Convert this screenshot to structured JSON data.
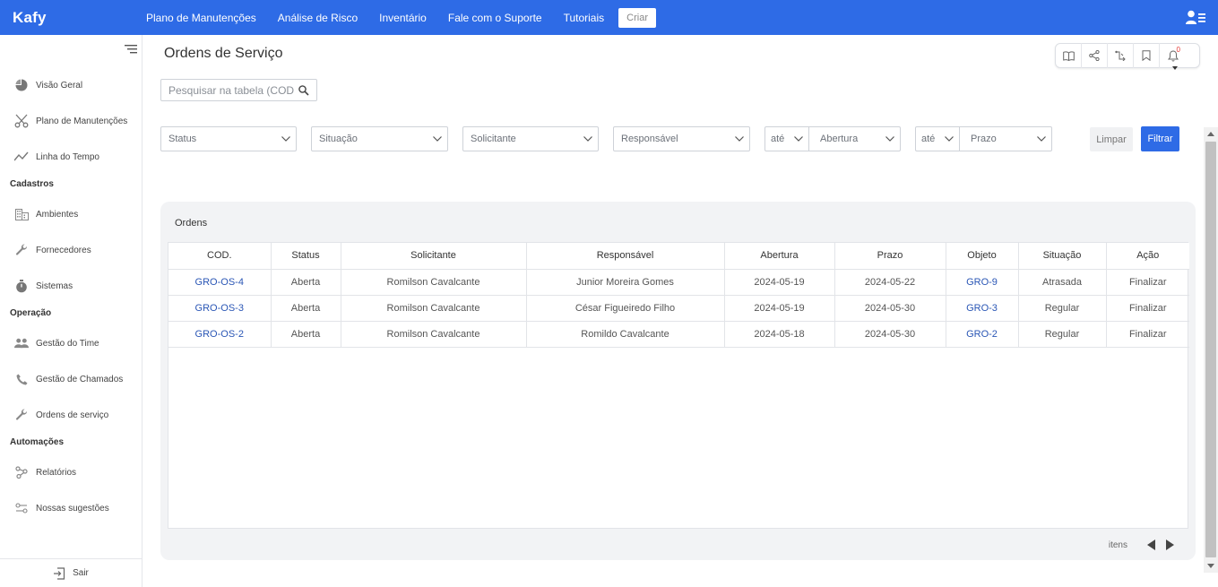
{
  "app": {
    "logo": "Kafy"
  },
  "topnav": {
    "items": [
      "Plano de Manutenções",
      "Análise de Risco",
      "Inventário",
      "Fale com o Suporte",
      "Tutoriais"
    ],
    "create_label": "Criar"
  },
  "sidebar": {
    "items": [
      {
        "label": "Visão Geral",
        "icon": "pie-chart-icon"
      },
      {
        "label": "Plano de Manutenções",
        "icon": "scissors-icon"
      },
      {
        "label": "Linha do Tempo",
        "icon": "line-chart-icon"
      },
      {
        "label": "Ambientes",
        "icon": "building-icon"
      },
      {
        "label": "Fornecedores",
        "icon": "wrench-icon"
      },
      {
        "label": "Sistemas",
        "icon": "stopwatch-icon"
      },
      {
        "label": "Gestão do Time",
        "icon": "team-icon"
      },
      {
        "label": "Gestão de Chamados",
        "icon": "phone-icon"
      },
      {
        "label": "Ordens de serviço",
        "icon": "wrench-icon"
      },
      {
        "label": "Relatórios",
        "icon": "nodes-icon"
      },
      {
        "label": "Nossas sugestões",
        "icon": "toggles-icon"
      }
    ],
    "sections": {
      "cadastros": "Cadastros",
      "operacao": "Operação",
      "automacoes": "Automações"
    },
    "logout_label": "Sair"
  },
  "page": {
    "title": "Ordens de Serviço",
    "search_placeholder": "Pesquisar na tabela (COD)",
    "notification_count": "0"
  },
  "filters": {
    "status": "Status",
    "situacao": "Situação",
    "solicitante": "Solicitante",
    "responsavel": "Responsável",
    "ate1": "até",
    "abertura": "Abertura",
    "ate2": "até",
    "prazo": "Prazo",
    "clear_label": "Limpar",
    "filter_label": "Filtrar"
  },
  "orders": {
    "title": "Ordens",
    "columns": [
      "COD.",
      "Status",
      "Solicitante",
      "Responsável",
      "Abertura",
      "Prazo",
      "Objeto",
      "Situação",
      "Ação"
    ],
    "rows": [
      [
        "GRO-OS-4",
        "Aberta",
        "Romilson Cavalcante",
        "Junior Moreira Gomes",
        "2024-05-19",
        "2024-05-22",
        "GRO-9",
        "Atrasada",
        "Finalizar"
      ],
      [
        "GRO-OS-3",
        "Aberta",
        "Romilson Cavalcante",
        "César Figueiredo Filho",
        "2024-05-19",
        "2024-05-30",
        "GRO-3",
        "Regular",
        "Finalizar"
      ],
      [
        "GRO-OS-2",
        "Aberta",
        "Romilson Cavalcante",
        "Romildo Cavalcante",
        "2024-05-18",
        "2024-05-30",
        "GRO-2",
        "Regular",
        "Finalizar"
      ]
    ],
    "pager_label": "itens"
  },
  "colors": {
    "primary": "#2e6be6",
    "link": "#2a56b5",
    "card_bg": "#f2f3f5"
  }
}
